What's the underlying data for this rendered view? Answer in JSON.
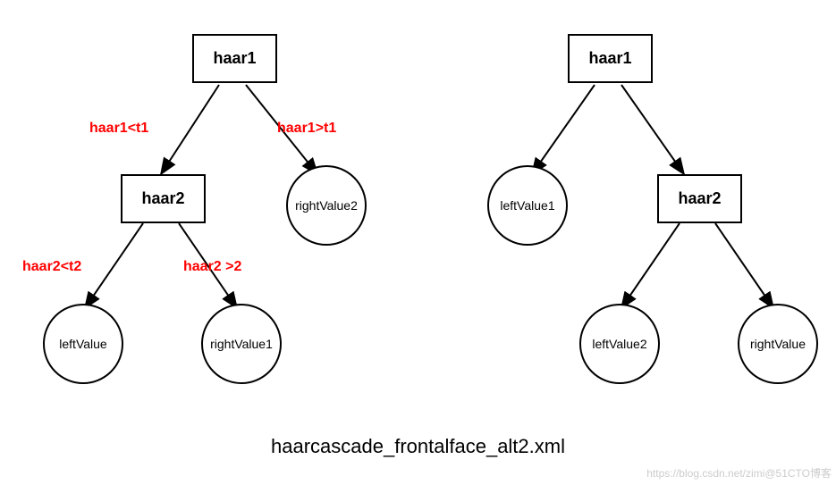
{
  "tree1": {
    "root": "haar1",
    "leftChild": "haar2",
    "rightLeaf": "rightValue2",
    "leftLeftLeaf": "leftValue",
    "leftRightLeaf": "rightValue1",
    "edgeLabels": {
      "rootLeft": "haar1<t1",
      "rootRight": "haar1>t1",
      "childLeft": "haar2<t2",
      "childRight": "haar2 >2"
    }
  },
  "tree2": {
    "root": "haar1",
    "leftLeaf": "leftValue1",
    "rightChild": "haar2",
    "rightLeftLeaf": "leftValue2",
    "rightRightLeaf": "rightValue"
  },
  "caption": "haarcascade_frontalface_alt2.xml",
  "watermark": "https://blog.csdn.net/zimi@51CTO博客"
}
